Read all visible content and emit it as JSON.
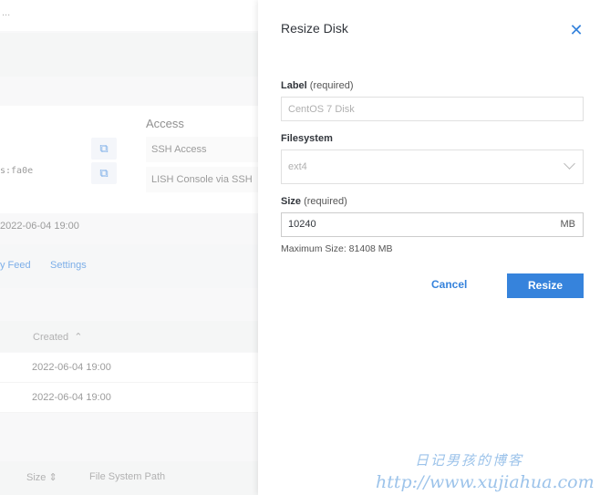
{
  "background": {
    "breadcrumb_text": "...",
    "access_title": "Access",
    "ssh_access_label": "SSH Access",
    "lish_label": "LISH Console via SSH",
    "mono_fragment": "s:fa0e",
    "created_fragment": "2022-06-04 19:00",
    "tabs": [
      "y Feed",
      "Settings"
    ],
    "table1": {
      "created_header": "Created",
      "rows": [
        "2022-06-04 19:00",
        "2022-06-04 19:00"
      ]
    },
    "table2": {
      "size_header": "Size",
      "path_header": "File System Path"
    }
  },
  "drawer": {
    "title": "Resize Disk",
    "label_field": {
      "label": "Label",
      "required": "(required)",
      "placeholder": "CentOS 7 Disk"
    },
    "filesystem_field": {
      "label": "Filesystem",
      "value": "ext4"
    },
    "size_field": {
      "label": "Size",
      "required": "(required)",
      "value": "10240",
      "unit": "MB"
    },
    "max_size_hint": "Maximum Size: 81408 MB",
    "cancel_label": "Cancel",
    "resize_label": "Resize"
  },
  "watermark": {
    "line1": "日记男孩的博客",
    "line2": "http://www.xujiahua.com"
  },
  "colors": {
    "accent": "#3683dc"
  }
}
